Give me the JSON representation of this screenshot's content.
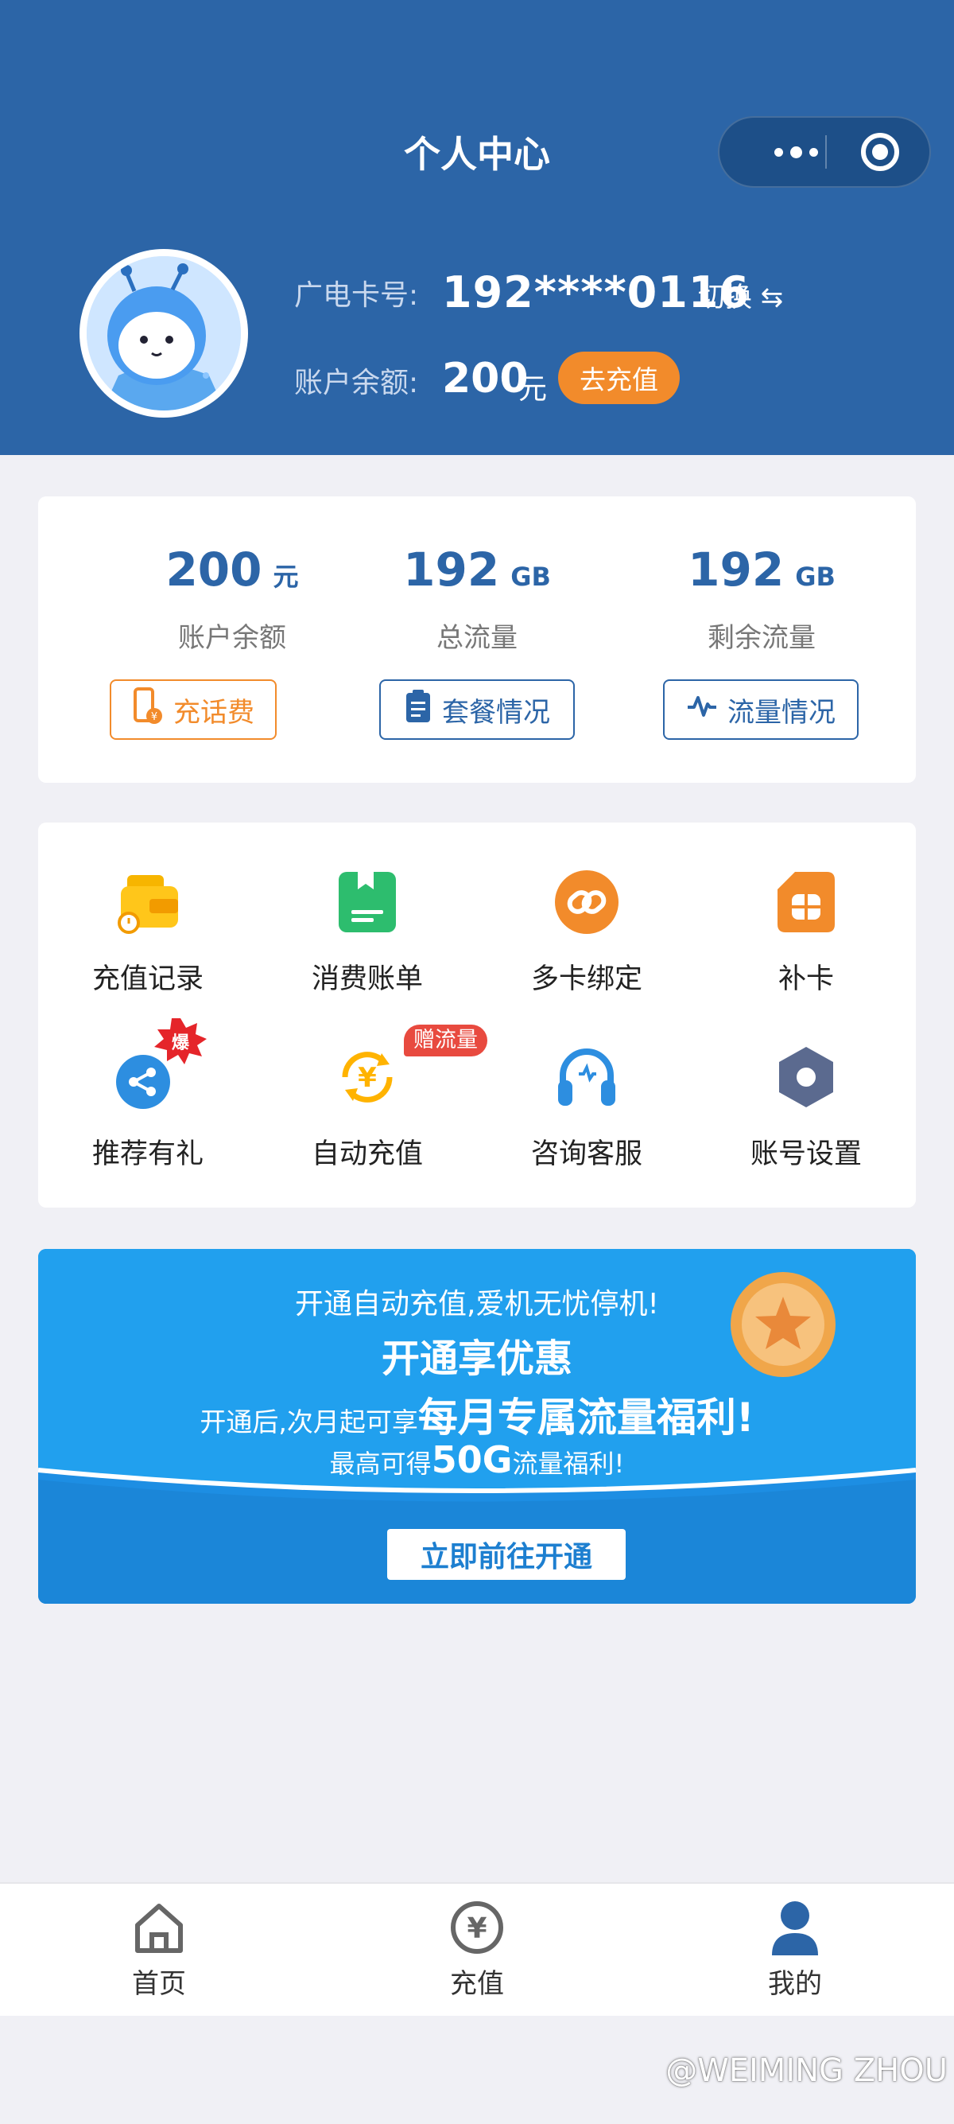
{
  "header": {
    "title": "个人中心",
    "card_label": "广电卡号:",
    "card_number": "192****0116",
    "switch_label": "切换 ⇆",
    "balance_label": "账户余额:",
    "balance_value": "200",
    "balance_unit": "元",
    "recharge_button": "去充值"
  },
  "stats": [
    {
      "value": "200",
      "unit": "元",
      "label": "账户余额",
      "button": "充话费",
      "icon": "phone-yuan-icon"
    },
    {
      "value": "192",
      "unit": "GB",
      "label": "总流量",
      "button": "套餐情况",
      "icon": "clipboard-icon"
    },
    {
      "value": "192",
      "unit": "GB",
      "label": "剩余流量",
      "button": "流量情况",
      "icon": "pulse-icon"
    }
  ],
  "grid": [
    {
      "label": "充值记录",
      "icon": "wallet-icon"
    },
    {
      "label": "消费账单",
      "icon": "bill-icon"
    },
    {
      "label": "多卡绑定",
      "icon": "link-icon"
    },
    {
      "label": "补卡",
      "icon": "sim-card-icon"
    },
    {
      "label": "推荐有礼",
      "icon": "share-icon",
      "badge": "爆"
    },
    {
      "label": "自动充值",
      "icon": "auto-recharge-icon",
      "badge": "赠流量"
    },
    {
      "label": "咨询客服",
      "icon": "headset-icon"
    },
    {
      "label": "账号设置",
      "icon": "hex-settings-icon"
    }
  ],
  "banner": {
    "line1": "开通自动充值,爱机无忧停机!",
    "line2": "开通享优惠",
    "line3_prefix": "开通后,次月起可享",
    "line3_highlight": "每月专属流量福利!",
    "line4_prefix": "最高可得",
    "line4_highlight": "50G",
    "line4_suffix": "流量福利!",
    "button": "立即前往开通"
  },
  "tabbar": [
    {
      "label": "首页",
      "icon": "home-icon",
      "active": false
    },
    {
      "label": "充值",
      "icon": "yuan-icon",
      "active": false
    },
    {
      "label": "我的",
      "icon": "user-icon",
      "active": true
    }
  ],
  "watermark": "@WEIMING ZHOU",
  "colors": {
    "primary": "#2c65a7",
    "accent": "#f28b2b",
    "banner": "#1d8ee3",
    "badge_red": "#e84a3f"
  }
}
